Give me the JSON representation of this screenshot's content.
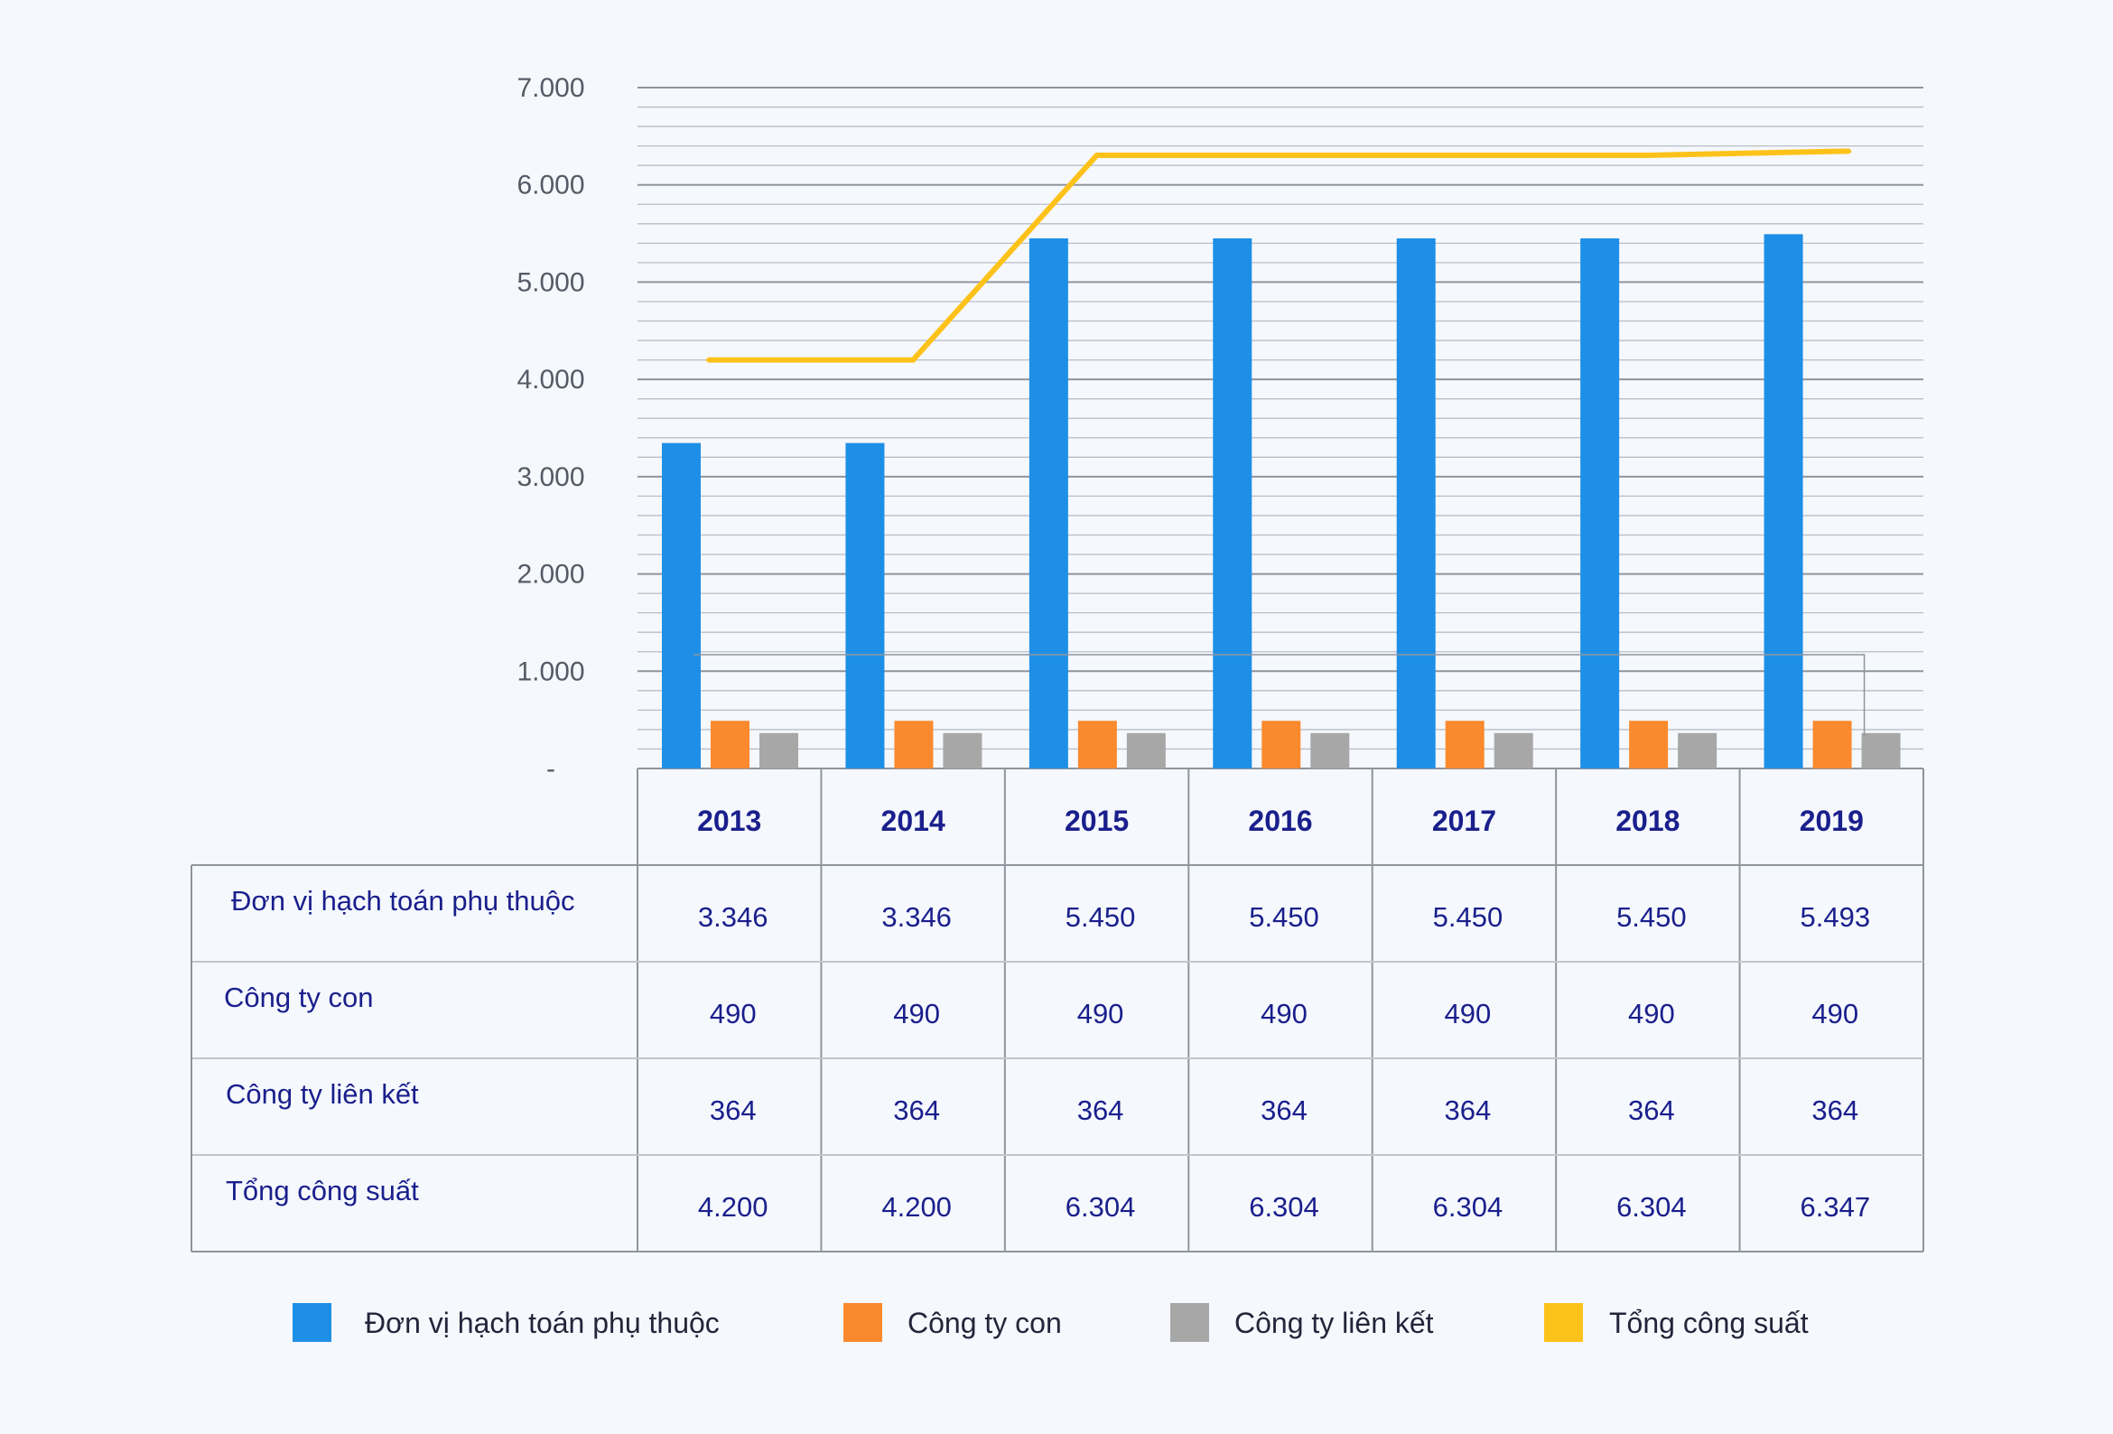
{
  "chart_data": {
    "type": "bar",
    "categories": [
      "2013",
      "2014",
      "2015",
      "2016",
      "2017",
      "2018",
      "2019"
    ],
    "series": [
      {
        "name": "Đơn vị hạch toán phụ thuộc",
        "type": "bar",
        "color": "#1e8fe6",
        "values": [
          3346,
          3346,
          5450,
          5450,
          5450,
          5450,
          5493
        ]
      },
      {
        "name": "Công ty con",
        "type": "bar",
        "color": "#fb8a2e",
        "values": [
          490,
          490,
          490,
          490,
          490,
          490,
          490
        ]
      },
      {
        "name": "Công ty liên kết",
        "type": "bar",
        "color": "#a7a7a7",
        "values": [
          364,
          364,
          364,
          364,
          364,
          364,
          364
        ]
      },
      {
        "name": "Tổng công suất",
        "type": "line",
        "color": "#fdc21a",
        "values": [
          4200,
          4200,
          6304,
          6304,
          6304,
          6304,
          6347
        ]
      }
    ],
    "ylim": [
      0,
      7000
    ],
    "yticks": [
      0,
      1000,
      2000,
      3000,
      4000,
      5000,
      6000,
      7000
    ],
    "ytick_labels": [
      "-",
      "1.000",
      "2.000",
      "3.000",
      "4.000",
      "5.000",
      "6.000",
      "7.000"
    ],
    "grid": true,
    "legend_position": "bottom",
    "table": {
      "rows": [
        {
          "label": "Đơn vị hạch toán phụ thuộc",
          "cells": [
            "3.346",
            "3.346",
            "5.450",
            "5.450",
            "5.450",
            "5.450",
            "5.493"
          ]
        },
        {
          "label": "Công ty con",
          "cells": [
            "490",
            "490",
            "490",
            "490",
            "490",
            "490",
            "490"
          ]
        },
        {
          "label": "Công ty liên kết",
          "cells": [
            "364",
            "364",
            "364",
            "364",
            "364",
            "364",
            "364"
          ]
        },
        {
          "label": "Tổng công suất",
          "cells": [
            "4.200",
            "4.200",
            "6.304",
            "6.304",
            "6.304",
            "6.304",
            "6.347"
          ]
        }
      ]
    }
  }
}
